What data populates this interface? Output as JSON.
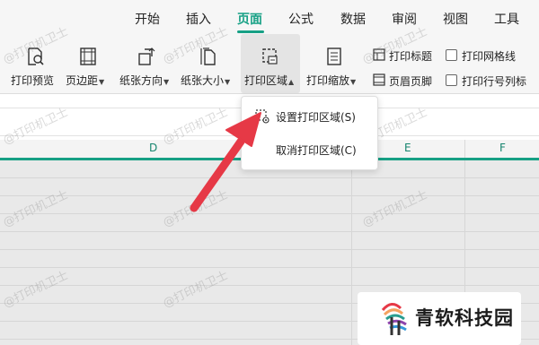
{
  "menu": {
    "tabs": [
      {
        "label": "开始"
      },
      {
        "label": "插入"
      },
      {
        "label": "页面"
      },
      {
        "label": "公式"
      },
      {
        "label": "数据"
      },
      {
        "label": "审阅"
      },
      {
        "label": "视图"
      },
      {
        "label": "工具"
      }
    ],
    "active_tab": "页面",
    "accent_color": "#16a085"
  },
  "toolbar": {
    "print_preview": "打印预览",
    "margins": "页边距",
    "orientation": "纸张方向",
    "paper_size": "纸张大小",
    "print_area": "打印区域",
    "print_scale": "打印缩放",
    "print_titles": "打印标题",
    "header_footer": "页眉页脚",
    "print_gridlines": "打印网格线",
    "print_row_col_headers": "打印行号列标"
  },
  "dropdown": {
    "set_print_area": "设置打印区域(S)",
    "clear_print_area": "取消打印区域(C)"
  },
  "columns": [
    "D",
    "E",
    "F"
  ],
  "watermark": "@打印机卫士",
  "logo": {
    "text": "青软科技园"
  },
  "annotation_arrow_color": "#e63946"
}
